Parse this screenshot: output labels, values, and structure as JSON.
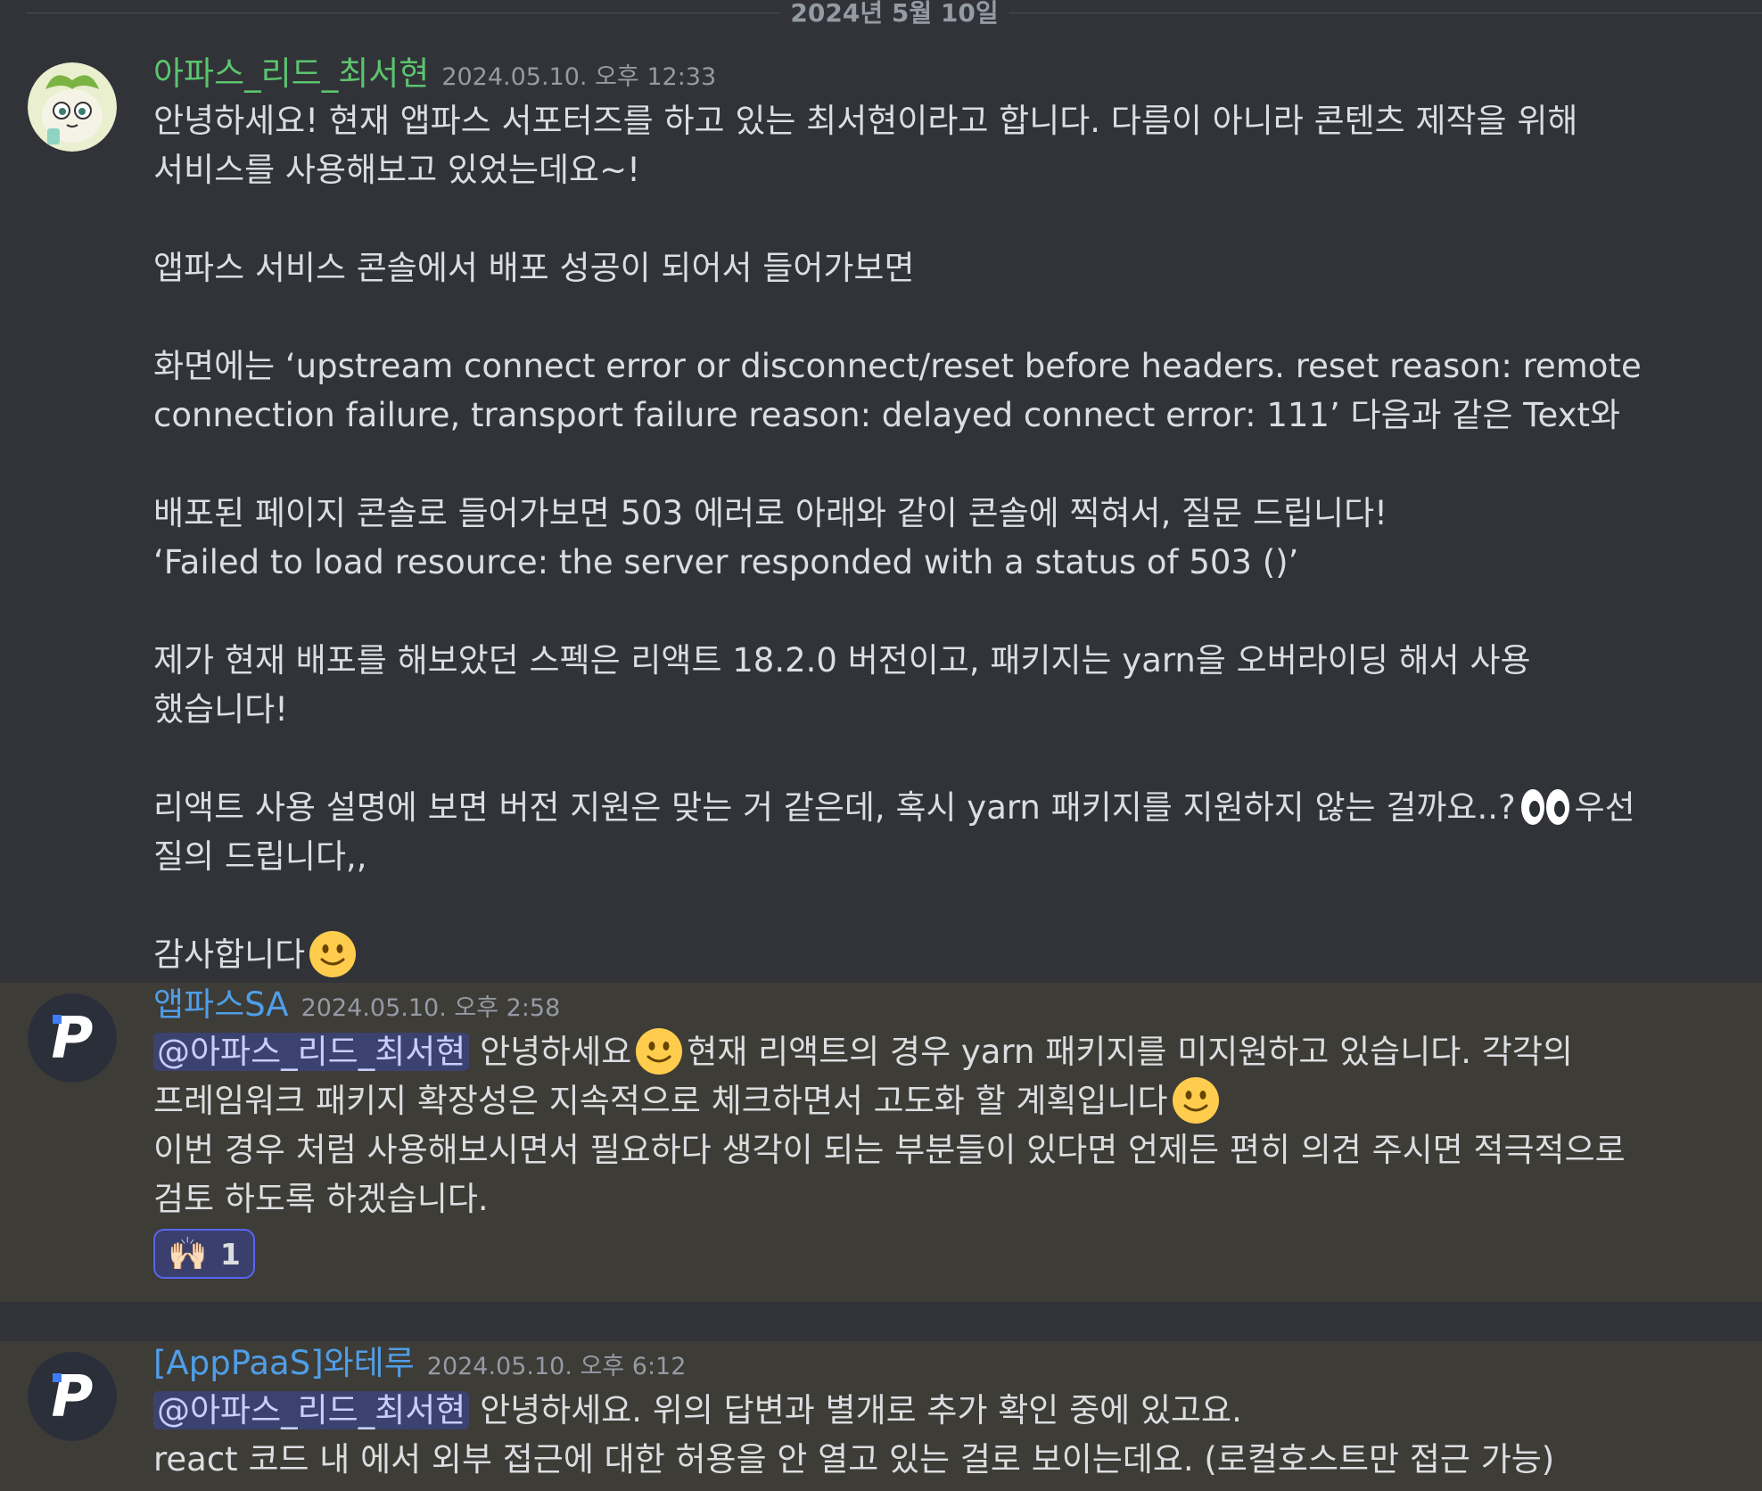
{
  "date_divider": "2024년 5월 10일",
  "messages": [
    {
      "author": "아파스_리드_최서현",
      "timestamp": "2024.05.10. 오후 12:33",
      "lines": {
        "l1": "안녕하세요! 현재 앱파스 서포터즈를 하고 있는 최서현이라고 합니다. 다름이 아니라 콘텐츠 제작을 위해 서비스를 사용해보고 있었는데요~!",
        "l2": "앱파스 서비스 콘솔에서 배포 성공이 되어서 들어가보면",
        "l3": "화면에는 ‘upstream connect error or disconnect/reset before headers. reset reason: remote connection failure, transport failure reason: delayed connect error: 111’ 다음과 같은 Text와",
        "l4": "배포된 페이지 콘솔로 들어가보면 503 에러로 아래와 같이 콘솔에 찍혀서, 질문 드립니다!",
        "l5": "‘Failed to load resource: the server responded with a status of 503 ()’",
        "l6": "제가 현재 배포를 해보았던 스펙은 리액트 18.2.0 버전이고, 패키지는 yarn을 오버라이딩 해서 사용 했습니다!",
        "l7a": "리액트 사용 설명에 보면 버전 지원은 맞는 거 같은데, 혹시 yarn 패키지를 지원하지 않는 걸까요..?",
        "l7b": "우선 질의 드립니다,,",
        "l8": "감사합니다"
      },
      "emojis": [
        "eyes-emoji",
        "slightly-smiling-face-emoji"
      ]
    },
    {
      "author": "앱파스SA",
      "timestamp": "2024.05.10. 오후 2:58",
      "mention": "@아파스_리드_최서현",
      "lines": {
        "l1a": "안녕하세요",
        "l1b": "현재 리액트의 경우 yarn 패키지를 미지원하고 있습니다. 각각의 프레임워크 패키지 확장성은 지속적으로 체크하면서 고도화 할 계획입니다",
        "l2": "이번 경우 처럼 사용해보시면서 필요하다 생각이 되는 부분들이 있다면 언제든 편히 의견 주시면 적극적으로 검토 하도록 하겠습니다."
      },
      "reaction": {
        "emoji": "🙌🏻",
        "count": "1"
      }
    },
    {
      "author": "[AppPaaS]와테루",
      "timestamp": "2024.05.10. 오후 6:12",
      "mention": "@아파스_리드_최서현",
      "lines": {
        "l1": "안녕하세요. 위의 답변과 별개로 추가 확인 중에 있고요.",
        "l2": "react 코드 내 에서 외부 접근에 대한 허용을 안 열고 있는 걸로 보이는데요. (로컬호스트만 접근 가능)"
      }
    }
  ],
  "colors": {
    "background": "#313338",
    "highlight": "#3e3c37",
    "author_green": "#5cc46e",
    "author_blue": "#4f9ee8",
    "mention_bg": "#3c4270",
    "reaction_border": "#5865f2"
  }
}
